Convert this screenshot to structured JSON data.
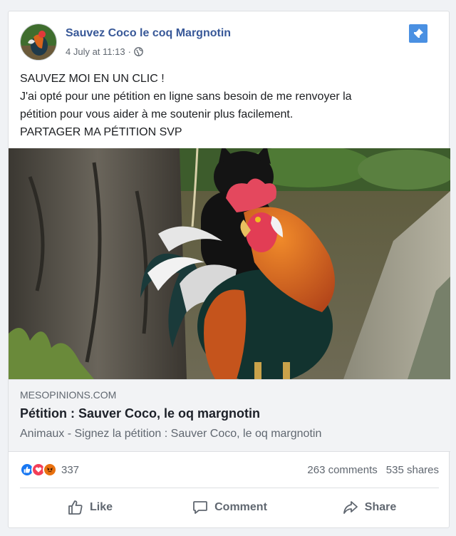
{
  "post": {
    "page_name": "Sauvez Coco le coq Margnotin",
    "timestamp": "4 July at 11:13",
    "separator": "·",
    "privacy_icon": "globe-icon",
    "pin_icon": "pin-icon",
    "text_lines": [
      "SAUVEZ MOI EN UN CLIC !",
      "J'ai opté pour une pétition en ligne sans besoin de me renvoyer la",
      "pétition pour vous aider à me soutenir plus facilement.",
      "PARTAGER MA PÉTITION SVP"
    ]
  },
  "link_preview": {
    "domain": "MESOPINIONS.COM",
    "title": "Pétition : Sauver Coco, le oq margnotin",
    "description": "Animaux - Signez la pétition : Sauver Coco, le oq margnotin"
  },
  "reactions": {
    "icons": [
      "like-icon",
      "love-icon",
      "angry-icon"
    ],
    "count": "337",
    "comments": "263 comments",
    "shares": "535 shares"
  },
  "actions": {
    "like": "Like",
    "comment": "Comment",
    "share": "Share"
  },
  "colors": {
    "link_blue": "#385898",
    "like_blue": "#1877f2",
    "love_red": "#f33e58",
    "angry_orange": "#e9710f",
    "pin_blue": "#4a90e2"
  }
}
